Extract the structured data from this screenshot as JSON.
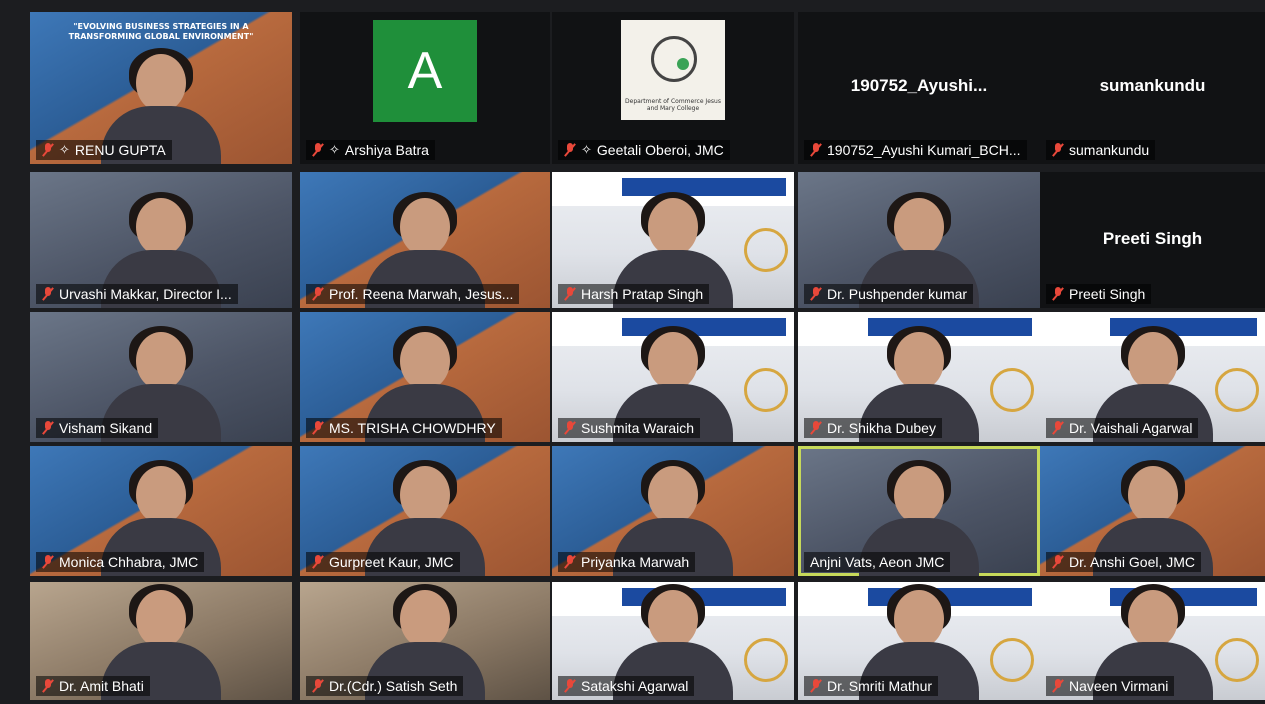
{
  "conference": {
    "title_line1": "\"EVOLVING BUSINESS STRATEGIES IN A",
    "title_line2": "TRANSFORMING GLOBAL ENVIRONMENT\""
  },
  "colors": {
    "muted": "#e8483a",
    "active_speaker": "#c7d95a"
  },
  "participants": [
    {
      "name": "RENU GUPTA",
      "muted": true,
      "pinned": true,
      "style": "conference-slide"
    },
    {
      "name": "Arshiya Batra",
      "muted": true,
      "pinned": true,
      "style": "avatar",
      "avatar_letter": "A"
    },
    {
      "name": "Geetali Oberoi, JMC",
      "muted": true,
      "pinned": true,
      "style": "logo",
      "logo_text": "Department of Commerce Jesus and Mary College"
    },
    {
      "name": "190752_Ayushi Kumari_BCH...",
      "muted": true,
      "style": "no-video",
      "display_name": "190752_Ayushi..."
    },
    {
      "name": "sumankundu",
      "muted": true,
      "style": "no-video",
      "display_name": "sumankundu"
    },
    {
      "name": "Urvashi Makkar, Director I...",
      "muted": true,
      "style": "video"
    },
    {
      "name": "Prof. Reena Marwah, Jesus...",
      "muted": true,
      "style": "poster"
    },
    {
      "name": "Harsh Pratap Singh",
      "muted": true,
      "style": "ims"
    },
    {
      "name": "Dr. Pushpender kumar",
      "muted": true,
      "style": "video"
    },
    {
      "name": "Preeti Singh",
      "muted": true,
      "style": "no-video",
      "display_name": "Preeti Singh"
    },
    {
      "name": "Visham Sikand",
      "muted": true,
      "style": "video"
    },
    {
      "name": "MS. TRISHA CHOWDHRY",
      "muted": true,
      "style": "poster"
    },
    {
      "name": "Sushmita Waraich",
      "muted": true,
      "style": "ims"
    },
    {
      "name": "Dr. Shikha Dubey",
      "muted": true,
      "style": "ims"
    },
    {
      "name": "Dr. Vaishali Agarwal",
      "muted": true,
      "style": "ims"
    },
    {
      "name": "Monica Chhabra, JMC",
      "muted": true,
      "style": "poster"
    },
    {
      "name": "Gurpreet Kaur, JMC",
      "muted": true,
      "style": "poster"
    },
    {
      "name": "Priyanka Marwah",
      "muted": true,
      "style": "poster"
    },
    {
      "name": "Anjni Vats, Aeon JMC",
      "muted": false,
      "active": true,
      "style": "video"
    },
    {
      "name": "Dr. Anshi Goel, JMC",
      "muted": true,
      "style": "poster"
    },
    {
      "name": "Dr. Amit Bhati",
      "muted": true,
      "style": "warm"
    },
    {
      "name": "Dr.(Cdr.) Satish Seth",
      "muted": true,
      "style": "warm"
    },
    {
      "name": "Satakshi Agarwal",
      "muted": true,
      "style": "ims"
    },
    {
      "name": "Dr. Smriti Mathur",
      "muted": true,
      "style": "ims"
    },
    {
      "name": "Naveen Virmani",
      "muted": true,
      "style": "ims"
    }
  ]
}
